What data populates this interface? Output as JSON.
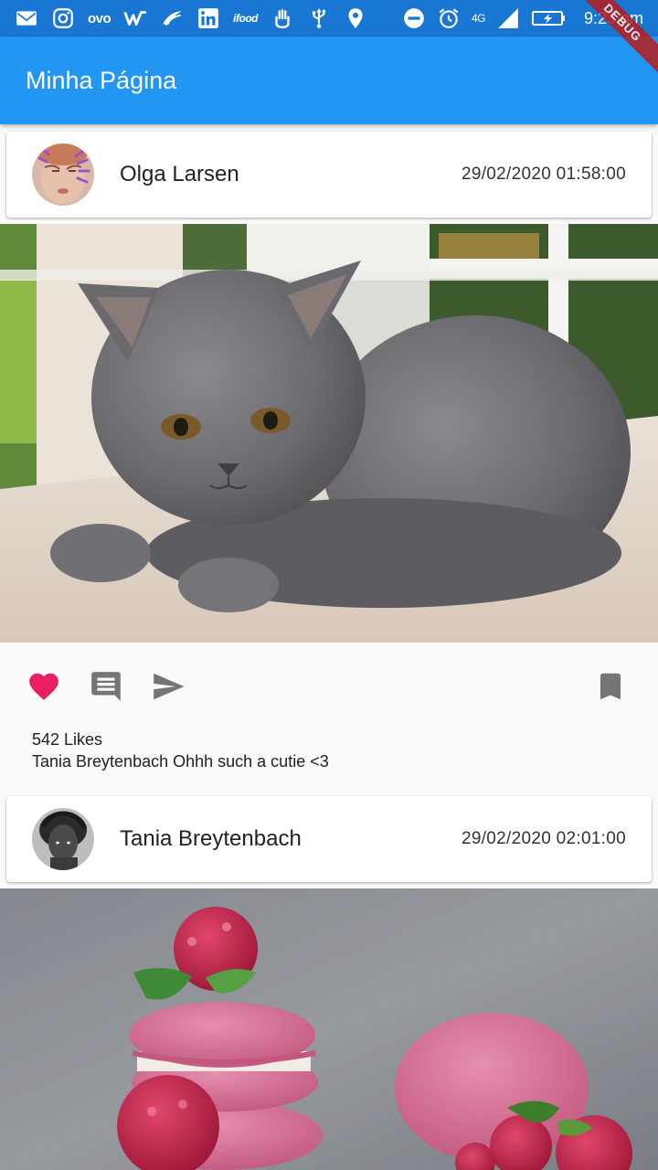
{
  "status_bar": {
    "network_label": "4G",
    "time": "9:23 pm",
    "left_icons": [
      "gmail-icon",
      "instagram-icon",
      "ovo-icon",
      "w-app-icon",
      "swoosh-app-icon",
      "linkedin-icon",
      "ifood-icon",
      "hand-app-icon",
      "usb-icon",
      "location-icon"
    ],
    "right_icons": [
      "do-not-disturb-icon",
      "alarm-icon",
      "signal-icon",
      "battery-charging-icon"
    ],
    "ovo_label": "ovo",
    "ifood_label": "ifood",
    "linkedin_label": "in"
  },
  "debug_banner": "DEBUG",
  "app_bar": {
    "title": "Minha Página"
  },
  "colors": {
    "app_bar": "#2196f3",
    "status_bar": "#1976d2",
    "like": "#e91e63",
    "icon_gray": "#757575"
  },
  "posts": [
    {
      "author": "Olga Larsen",
      "date": "29/02/2020 01:58:00",
      "avatar_icon": "avatar-olga",
      "image": "gray kitten photo",
      "liked": true,
      "likes_text": "542 Likes",
      "comment_user": "Tania Breytenbach",
      "comment_text": "Ohhh such a cutie <3"
    },
    {
      "author": "Tania Breytenbach",
      "date": "29/02/2020 02:01:00",
      "avatar_icon": "avatar-tania",
      "image": "raspberry macarons photo"
    }
  ],
  "actions": {
    "like_icon": "heart-icon",
    "comment_icon": "comment-icon",
    "share_icon": "send-icon",
    "save_icon": "bookmark-icon"
  }
}
